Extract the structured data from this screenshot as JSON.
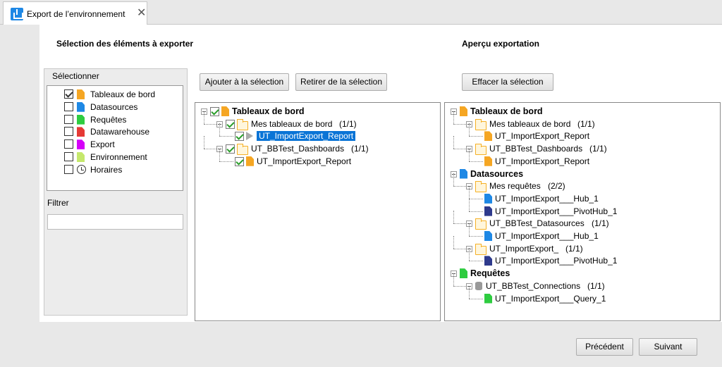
{
  "tab": {
    "title": "Export de l’environnement",
    "close": "✕"
  },
  "left_heading": "Sélection des éléments à exporter",
  "right_heading": "Aperçu exportation",
  "selector": {
    "title": "Sélectionner",
    "types": [
      {
        "label": "Tableaux de bord",
        "checked": true,
        "color": "#f5a623"
      },
      {
        "label": "Datasources",
        "checked": false,
        "color": "#1e88e5"
      },
      {
        "label": "Requêtes",
        "checked": false,
        "color": "#2ecc40"
      },
      {
        "label": "Datawarehouse",
        "checked": false,
        "color": "#e53935"
      },
      {
        "label": "Export",
        "checked": false,
        "color": "#d500f9"
      },
      {
        "label": "Environnement",
        "checked": false,
        "color": "#c5e86c"
      },
      {
        "label": "Horaires",
        "checked": false,
        "color": "clock"
      }
    ],
    "filter_label": "Filtrer",
    "filter_value": ""
  },
  "buttons": {
    "add": "Ajouter à la sélection",
    "remove": "Retirer de la sélection",
    "clear": "Effacer la sélection",
    "previous": "Précédent",
    "next": "Suivant"
  },
  "selection_tree": [
    {
      "label": "Tableaux de bord",
      "bold": true,
      "depth": 0,
      "icon": "doc",
      "color": "#f5a623"
    },
    {
      "label": "Mes tableaux de bord",
      "count": "(1/1)",
      "depth": 1,
      "icon": "folder"
    },
    {
      "label": "UT_ImportExport_Report",
      "depth": 2,
      "icon": "play",
      "selected": true
    },
    {
      "label": "UT_BBTest_Dashboards",
      "count": "(1/1)",
      "depth": 1,
      "icon": "folder"
    },
    {
      "label": "UT_ImportExport_Report",
      "depth": 2,
      "icon": "doc",
      "color": "#f5a623"
    }
  ],
  "preview_tree": [
    {
      "label": "Tableaux de bord",
      "bold": true,
      "depth": 0,
      "icon": "doc",
      "color": "#f5a623"
    },
    {
      "label": "Mes tableaux de bord",
      "count": "(1/1)",
      "depth": 1,
      "icon": "folder"
    },
    {
      "label": "UT_ImportExport_Report",
      "depth": 2,
      "icon": "doc",
      "color": "#f5a623"
    },
    {
      "label": "UT_BBTest_Dashboards",
      "count": "(1/1)",
      "depth": 1,
      "icon": "folder"
    },
    {
      "label": "UT_ImportExport_Report",
      "depth": 2,
      "icon": "doc",
      "color": "#f5a623"
    },
    {
      "label": "Datasources",
      "bold": true,
      "depth": 0,
      "icon": "doc",
      "color": "#1e88e5"
    },
    {
      "label": "Mes requêtes",
      "count": "(2/2)",
      "depth": 1,
      "icon": "folder"
    },
    {
      "label": "UT_ImportExport___Hub_1",
      "depth": 2,
      "icon": "doc",
      "color": "#1e88e5"
    },
    {
      "label": "UT_ImportExport___PivotHub_1",
      "depth": 2,
      "icon": "doc",
      "color": "#2e3a8c"
    },
    {
      "label": "UT_BBTest_Datasources",
      "count": "(1/1)",
      "depth": 1,
      "icon": "folder"
    },
    {
      "label": "UT_ImportExport___Hub_1",
      "depth": 2,
      "icon": "doc",
      "color": "#1e88e5"
    },
    {
      "label": "UT_ImportExport_",
      "count": "(1/1)",
      "depth": 1,
      "icon": "folder"
    },
    {
      "label": "UT_ImportExport___PivotHub_1",
      "depth": 2,
      "icon": "doc",
      "color": "#2e3a8c"
    },
    {
      "label": "Requêtes",
      "bold": true,
      "depth": 0,
      "icon": "doc",
      "color": "#2ecc40"
    },
    {
      "label": "UT_BBTest_Connections",
      "count": "(1/1)",
      "depth": 1,
      "icon": "db"
    },
    {
      "label": "UT_ImportExport___Query_1",
      "depth": 2,
      "icon": "doc",
      "color": "#2ecc40"
    }
  ]
}
